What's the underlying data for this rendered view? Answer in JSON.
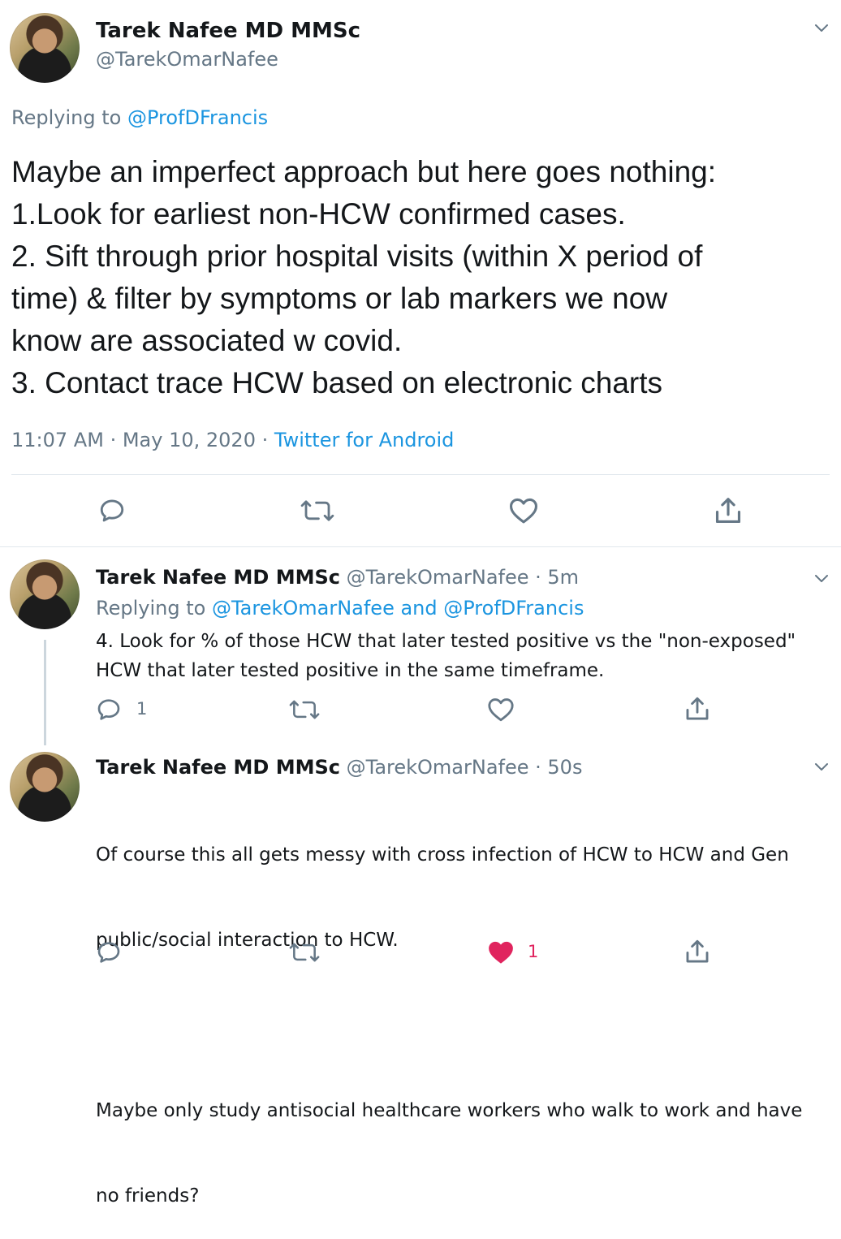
{
  "main_tweet": {
    "author_name": "Tarek Nafee MD MMSc",
    "handle": "@TarekOmarNafee",
    "replying_prefix": "Replying to",
    "replying_handle": "@ProfDFrancis",
    "body_lines": [
      "Maybe an imperfect approach but here goes nothing:",
      "1.Look for earliest non-HCW confirmed cases.",
      "2. Sift through prior hospital visits (within X period of",
      "time) & filter by symptoms or lab markers we now",
      "know are associated w covid.",
      "3. Contact trace HCW based on electronic charts"
    ],
    "time": "11:07 AM",
    "date": "May 10, 2020",
    "source": "Twitter for Android"
  },
  "reply1": {
    "author_name": "Tarek Nafee MD MMSc",
    "handle": "@TarekOmarNafee",
    "age": "· 5m",
    "replying_prefix": "Replying to",
    "replying_handles": "@TarekOmarNafee and @ProfDFrancis",
    "body_lines": [
      "4. Look for % of those HCW that later tested positive vs the \"non-exposed\"",
      "HCW that later tested positive in the same timeframe."
    ],
    "reply_count": "1"
  },
  "reply2": {
    "author_name": "Tarek Nafee MD MMSc",
    "handle": "@TarekOmarNafee",
    "age": "· 50s",
    "body_lines": [
      "Of course this all gets messy with cross infection of HCW to HCW and Gen",
      "public/social interaction to HCW.",
      "",
      "Maybe only study antisocial healthcare workers who walk to work and have",
      "no friends?"
    ],
    "like_count": "1"
  },
  "icons": {
    "reply": "reply-icon",
    "retweet": "retweet-icon",
    "like": "heart-icon",
    "share": "share-icon",
    "caret": "chevron-down-icon"
  },
  "colors": {
    "link": "#1b95e0",
    "muted": "#657786",
    "liked": "#e0245e"
  }
}
